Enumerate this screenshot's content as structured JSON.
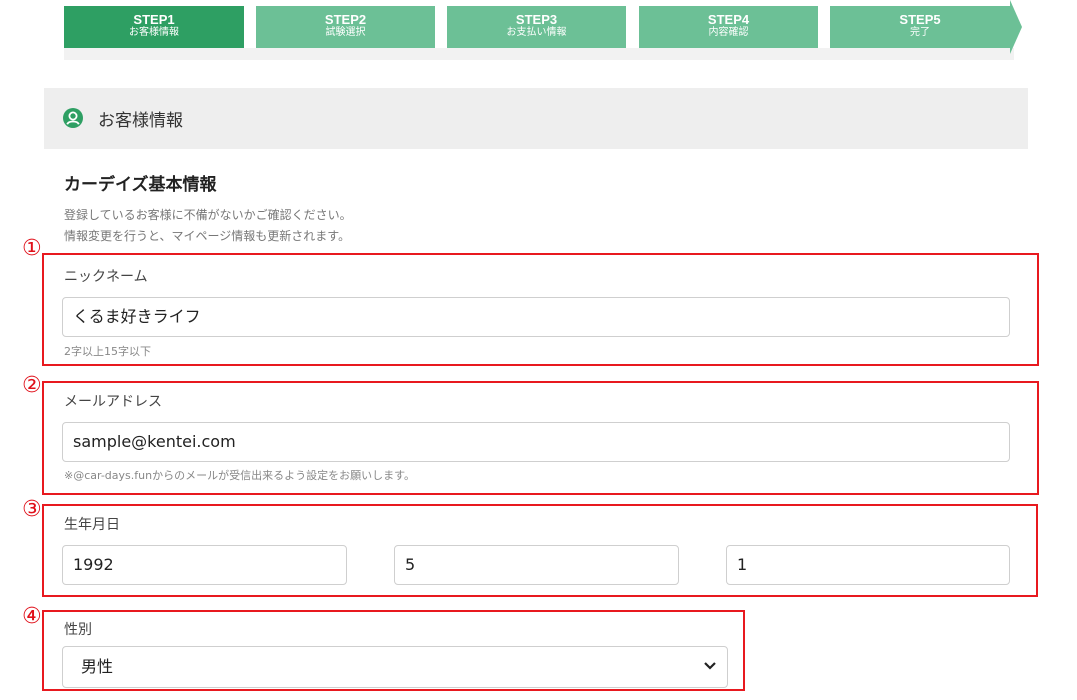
{
  "steps": [
    {
      "title": "STEP1",
      "subtitle": "お客様情報",
      "active": true
    },
    {
      "title": "STEP2",
      "subtitle": "試験選択",
      "active": false
    },
    {
      "title": "STEP3",
      "subtitle": "お支払い情報",
      "active": false
    },
    {
      "title": "STEP4",
      "subtitle": "内容確認",
      "active": false
    },
    {
      "title": "STEP5",
      "subtitle": "完了",
      "active": false
    }
  ],
  "section": {
    "title": "お客様情報",
    "icon": "user-icon"
  },
  "basic": {
    "title": "カーデイズ基本情報",
    "desc1": "登録しているお客様に不備がないかご確認ください。",
    "desc2": "情報変更を行うと、マイページ情報も更新されます。"
  },
  "markers": [
    "①",
    "②",
    "③",
    "④"
  ],
  "nickname": {
    "label": "ニックネーム",
    "value": "くるま好きライフ",
    "hint": "2字以上15字以下"
  },
  "email": {
    "label": "メールアドレス",
    "value": "sample@kentei.com",
    "hint": "※@car-days.funからのメールが受信出来るよう設定をお願いします。"
  },
  "birthday": {
    "label": "生年月日",
    "year": "1992",
    "month": "5",
    "day": "1"
  },
  "gender": {
    "label": "性別",
    "selected": "男性"
  },
  "colors": {
    "active_step": "#2e9f63",
    "inactive_step": "#6cc096",
    "annotation_red": "#e8191f"
  }
}
